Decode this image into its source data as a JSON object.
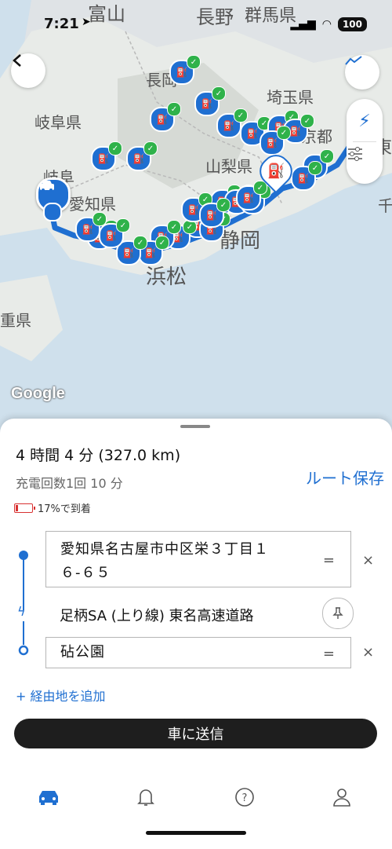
{
  "status": {
    "time": "7:21",
    "battery": "100"
  },
  "map": {
    "labels": [
      {
        "text": "富山",
        "size": 24
      },
      {
        "text": "長野",
        "size": 24
      },
      {
        "text": "群馬県",
        "size": 22
      },
      {
        "text": "長岡",
        "size": 20
      },
      {
        "text": "埼玉県",
        "size": 20
      },
      {
        "text": "岐阜県",
        "size": 20
      },
      {
        "text": "京都",
        "size": 20
      },
      {
        "text": "岐阜",
        "size": 20
      },
      {
        "text": "山梨県",
        "size": 20
      },
      {
        "text": "愛知県",
        "size": 20
      },
      {
        "text": "静岡",
        "size": 26
      },
      {
        "text": "浜松",
        "size": 26
      },
      {
        "text": "重県",
        "size": 20
      },
      {
        "text": "千",
        "size": 20
      },
      {
        "text": "東",
        "size": 22
      }
    ],
    "google_label": "Google"
  },
  "sheet": {
    "trip_summary": "4 時間 4 分 (327.0 km)",
    "charge_info": "充電回数1回 10 分",
    "save_route": "ルート保存",
    "arrival": "17%で到着",
    "origin_line1": "愛知県名古屋市中区栄３丁目１",
    "origin_line2": "６-６５",
    "waypoint": "足柄SA (上り線) 東名高速道路",
    "destination": "砧公園",
    "add_stop": "+  経由地を追加",
    "send_button": "車に送信",
    "eq_symbol": "=",
    "close_symbol": "×"
  },
  "tabs": [
    "car-icon",
    "bell-icon",
    "help-icon",
    "profile-icon"
  ],
  "colors": {
    "route": "#1f6fd1",
    "charger_check": "#2fb24a",
    "accent": "#1f6fd1"
  }
}
